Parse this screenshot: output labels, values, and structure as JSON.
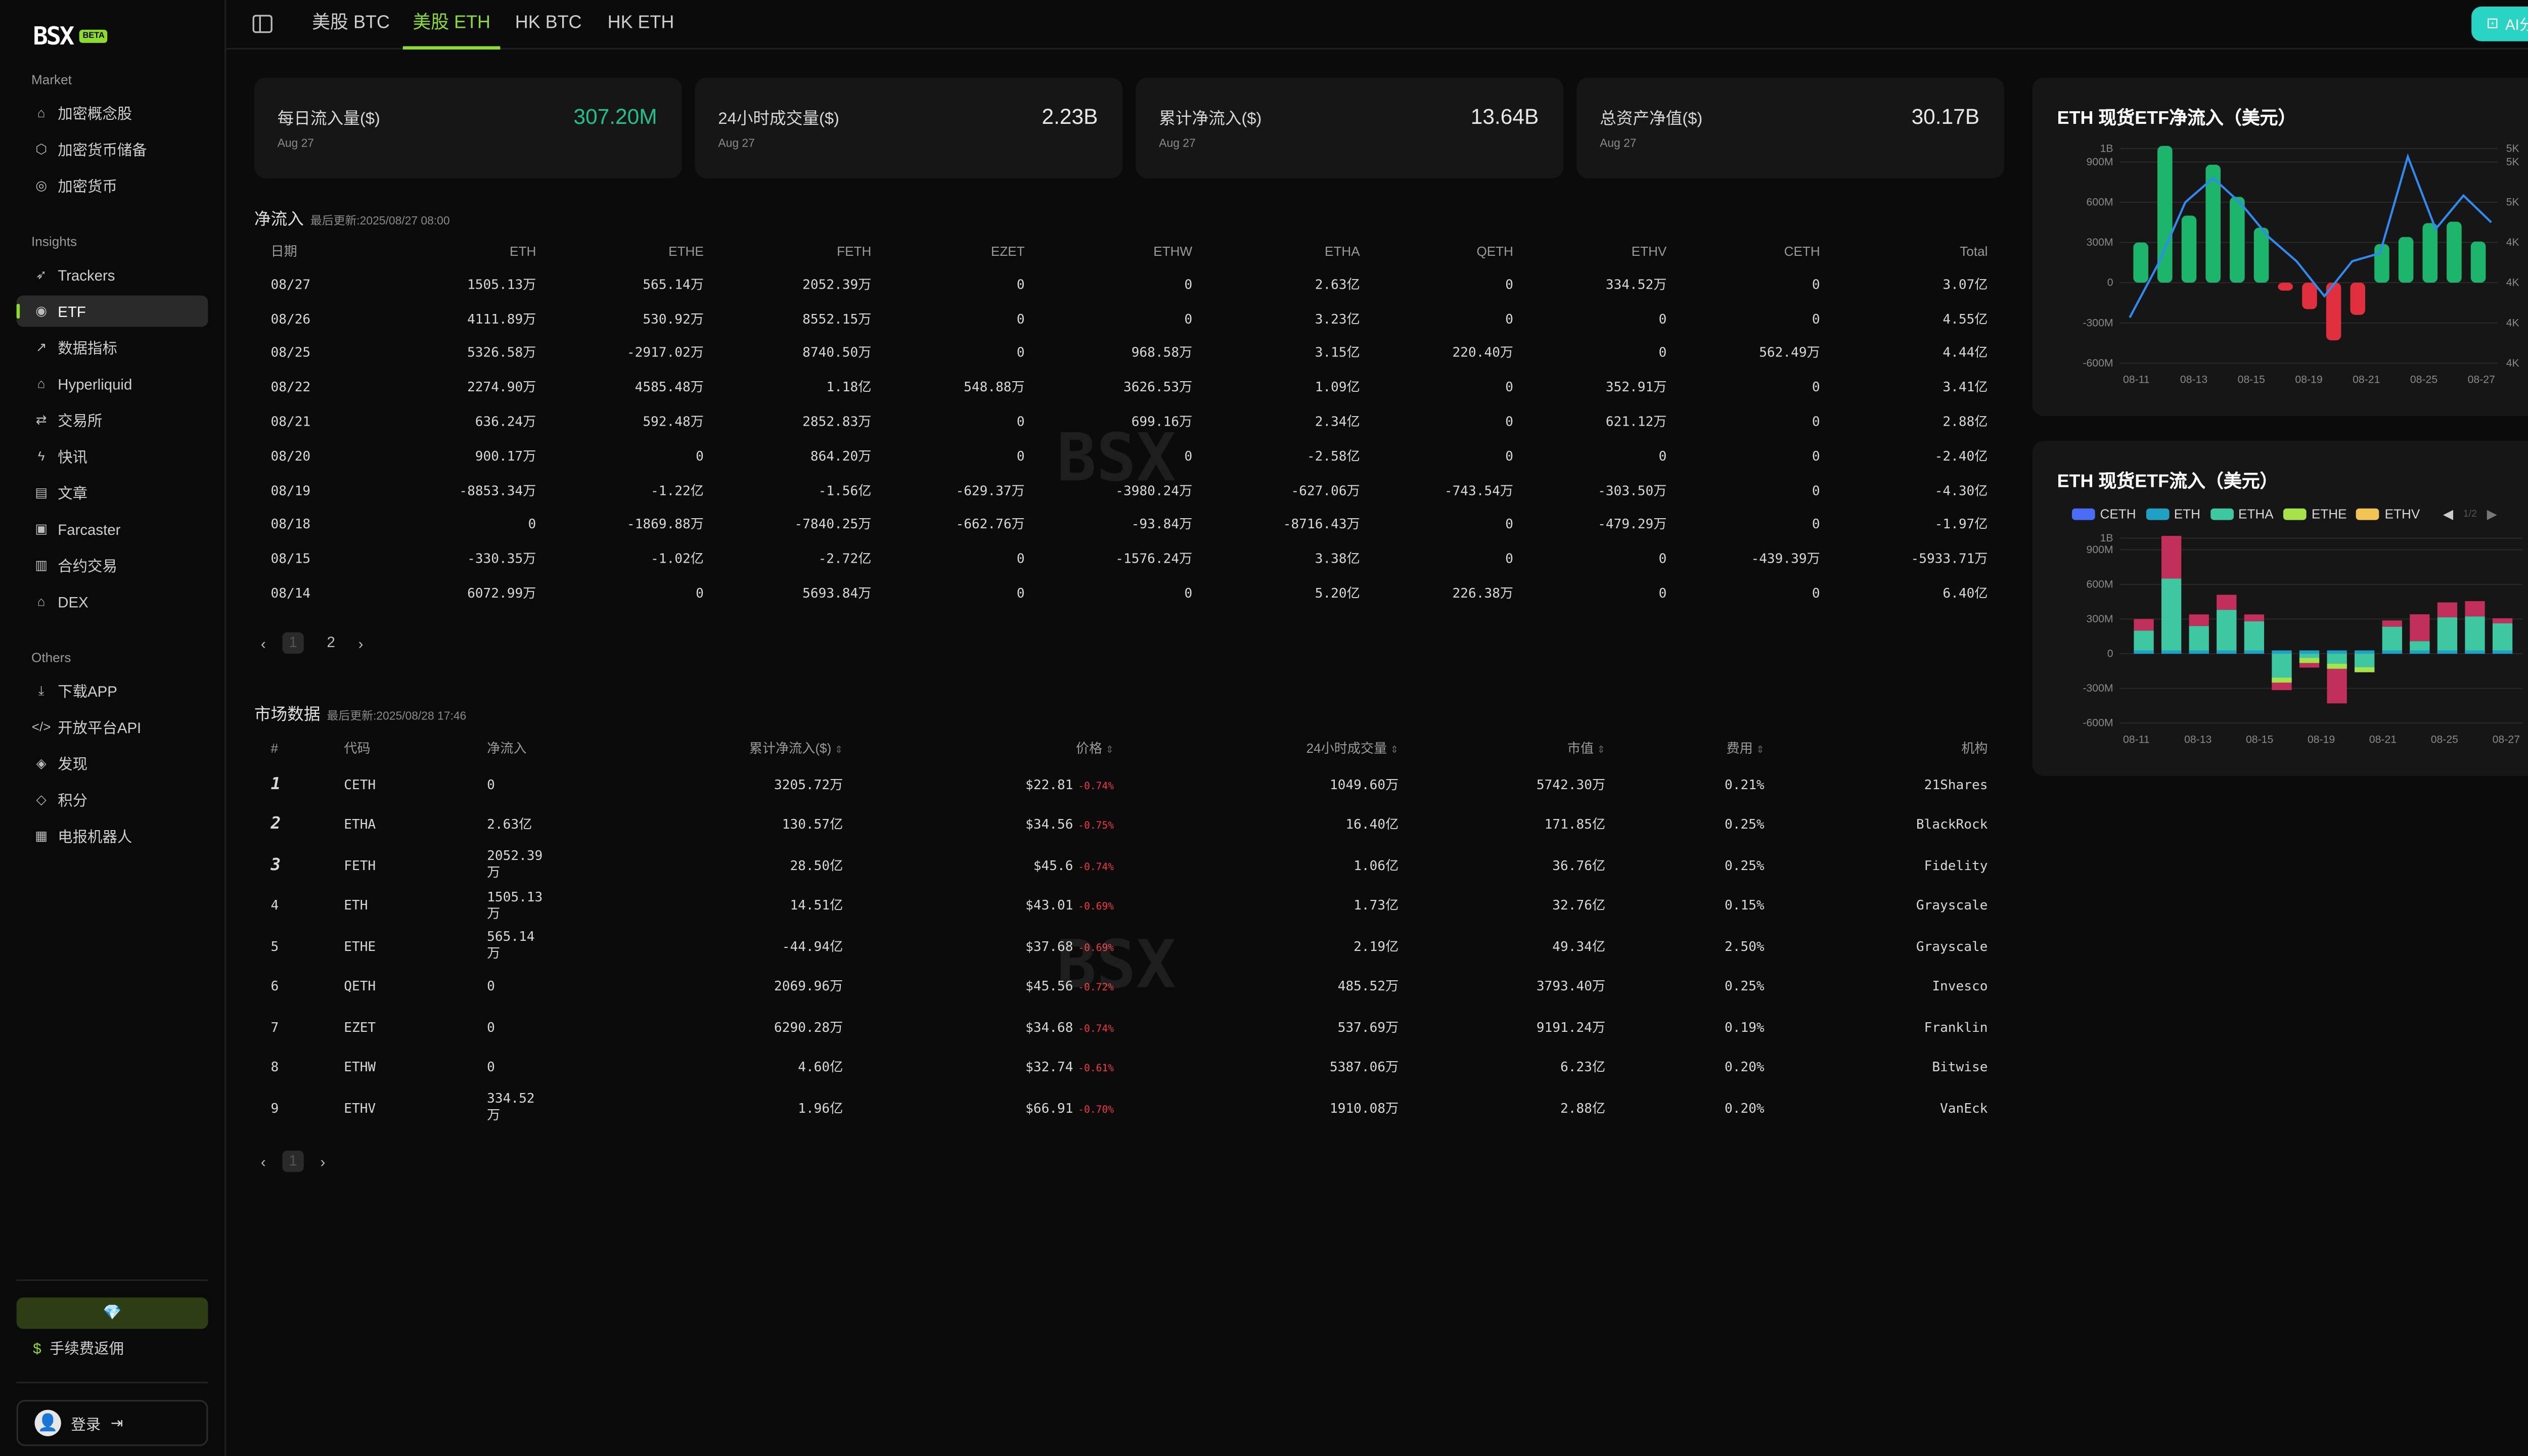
{
  "sidebar": {
    "logo": "BSX",
    "beta": "BETA",
    "sections": [
      {
        "title": "Market",
        "items": [
          {
            "label": "加密概念股",
            "icon": "building-icon"
          },
          {
            "label": "加密货币储备",
            "icon": "cube-icon"
          },
          {
            "label": "加密货币",
            "icon": "coin-icon"
          }
        ]
      },
      {
        "title": "Insights",
        "items": [
          {
            "label": "Trackers",
            "icon": "tracker-icon"
          },
          {
            "label": "ETF",
            "icon": "etf-icon"
          },
          {
            "label": "数据指标",
            "icon": "trend-icon"
          },
          {
            "label": "Hyperliquid",
            "icon": "home-icon"
          },
          {
            "label": "交易所",
            "icon": "exchange-icon"
          },
          {
            "label": "快讯",
            "icon": "bolt-icon"
          },
          {
            "label": "文章",
            "icon": "article-icon"
          },
          {
            "label": "Farcaster",
            "icon": "farcaster-icon"
          },
          {
            "label": "合约交易",
            "icon": "bar-chart-icon"
          },
          {
            "label": "DEX",
            "icon": "dex-icon"
          }
        ]
      },
      {
        "title": "Others",
        "items": [
          {
            "label": "下载APP",
            "icon": "download-icon"
          },
          {
            "label": "开放平台API",
            "icon": "code-icon"
          },
          {
            "label": "发现",
            "icon": "compass-icon"
          },
          {
            "label": "积分",
            "icon": "diamond-icon"
          },
          {
            "label": "电报机器人",
            "icon": "bot-icon"
          }
        ]
      }
    ],
    "rebate": "手续费返佣",
    "login": "登录"
  },
  "tabs": [
    "美股 BTC",
    "美股 ETH",
    "HK BTC",
    "HK ETH"
  ],
  "active_tab": "美股 ETH",
  "ai_button": "AI分析",
  "cards": [
    {
      "label": "每日流入量($)",
      "value": "307.20M",
      "date": "Aug 27"
    },
    {
      "label": "24小时成交量($)",
      "value": "2.23B",
      "date": "Aug 27"
    },
    {
      "label": "累计净流入($)",
      "value": "13.64B",
      "date": "Aug 27"
    },
    {
      "label": "总资产净值($)",
      "value": "30.17B",
      "date": "Aug 27"
    }
  ],
  "flow": {
    "title": "净流入",
    "updated": "最后更新:2025/08/27 08:00",
    "headers": [
      "日期",
      "ETH",
      "ETHE",
      "FETH",
      "EZET",
      "ETHW",
      "ETHA",
      "QETH",
      "ETHV",
      "CETH",
      "Total"
    ],
    "rows": [
      [
        "08/27",
        "1505.13万",
        "565.14万",
        "2052.39万",
        "0",
        "0",
        "2.63亿",
        "0",
        "334.52万",
        "0",
        "3.07亿"
      ],
      [
        "08/26",
        "4111.89万",
        "530.92万",
        "8552.15万",
        "0",
        "0",
        "3.23亿",
        "0",
        "0",
        "0",
        "4.55亿"
      ],
      [
        "08/25",
        "5326.58万",
        "-2917.02万",
        "8740.50万",
        "0",
        "968.58万",
        "3.15亿",
        "220.40万",
        "0",
        "562.49万",
        "4.44亿"
      ],
      [
        "08/22",
        "2274.90万",
        "4585.48万",
        "1.18亿",
        "548.88万",
        "3626.53万",
        "1.09亿",
        "0",
        "352.91万",
        "0",
        "3.41亿"
      ],
      [
        "08/21",
        "636.24万",
        "592.48万",
        "2852.83万",
        "0",
        "699.16万",
        "2.34亿",
        "0",
        "621.12万",
        "0",
        "2.88亿"
      ],
      [
        "08/20",
        "900.17万",
        "0",
        "864.20万",
        "0",
        "0",
        "-2.58亿",
        "0",
        "0",
        "0",
        "-2.40亿"
      ],
      [
        "08/19",
        "-8853.34万",
        "-1.22亿",
        "-1.56亿",
        "-629.37万",
        "-3980.24万",
        "-627.06万",
        "-743.54万",
        "-303.50万",
        "0",
        "-4.30亿"
      ],
      [
        "08/18",
        "0",
        "-1869.88万",
        "-7840.25万",
        "-662.76万",
        "-93.84万",
        "-8716.43万",
        "0",
        "-479.29万",
        "0",
        "-1.97亿"
      ],
      [
        "08/15",
        "-330.35万",
        "-1.02亿",
        "-2.72亿",
        "0",
        "-1576.24万",
        "3.38亿",
        "0",
        "0",
        "-439.39万",
        "-5933.71万"
      ],
      [
        "08/14",
        "6072.99万",
        "0",
        "5693.84万",
        "0",
        "0",
        "5.20亿",
        "226.38万",
        "0",
        "0",
        "6.40亿"
      ]
    ],
    "pages": [
      "1",
      "2"
    ]
  },
  "market": {
    "title": "市场数据",
    "updated": "最后更新:2025/08/28 17:46",
    "headers": [
      "#",
      "代码",
      "净流入",
      "累计净流入($)",
      "价格",
      "24小时成交量",
      "市值",
      "费用",
      "机构"
    ],
    "rows": [
      [
        "1",
        "CETH",
        "0",
        "3205.72万",
        "$22.81",
        "-0.74%",
        "1049.60万",
        "5742.30万",
        "0.21%",
        "21Shares"
      ],
      [
        "2",
        "ETHA",
        "2.63亿",
        "130.57亿",
        "$34.56",
        "-0.75%",
        "16.40亿",
        "171.85亿",
        "0.25%",
        "BlackRock"
      ],
      [
        "3",
        "FETH",
        "2052.39万",
        "28.50亿",
        "$45.6",
        "-0.74%",
        "1.06亿",
        "36.76亿",
        "0.25%",
        "Fidelity"
      ],
      [
        "4",
        "ETH",
        "1505.13万",
        "14.51亿",
        "$43.01",
        "-0.69%",
        "1.73亿",
        "32.76亿",
        "0.15%",
        "Grayscale"
      ],
      [
        "5",
        "ETHE",
        "565.14万",
        "-44.94亿",
        "$37.68",
        "-0.69%",
        "2.19亿",
        "49.34亿",
        "2.50%",
        "Grayscale"
      ],
      [
        "6",
        "QETH",
        "0",
        "2069.96万",
        "$45.56",
        "-0.72%",
        "485.52万",
        "3793.40万",
        "0.25%",
        "Invesco"
      ],
      [
        "7",
        "EZET",
        "0",
        "6290.28万",
        "$34.68",
        "-0.74%",
        "537.69万",
        "9191.24万",
        "0.19%",
        "Franklin"
      ],
      [
        "8",
        "ETHW",
        "0",
        "4.60亿",
        "$32.74",
        "-0.61%",
        "5387.06万",
        "6.23亿",
        "0.20%",
        "Bitwise"
      ],
      [
        "9",
        "ETHV",
        "334.52万",
        "1.96亿",
        "$66.91",
        "-0.70%",
        "1910.08万",
        "2.88亿",
        "0.20%",
        "VanEck"
      ]
    ],
    "pages": [
      "1"
    ]
  },
  "chart_data": [
    {
      "type": "bar",
      "title": "ETH 现货ETF净流入（美元）",
      "categories": [
        "08-11",
        "08-12",
        "08-13",
        "08-14",
        "08-15",
        "08-18",
        "08-19",
        "08-20",
        "08-21",
        "08-22",
        "08-25",
        "08-26",
        "08-27"
      ],
      "x_tick_labels": [
        "08-11",
        "08-13",
        "08-15",
        "08-19",
        "08-21",
        "08-25",
        "08-27"
      ],
      "y_ticks": [
        "1B",
        "900M",
        "600M",
        "300M",
        "0",
        "-300M",
        "-600M"
      ],
      "y2_ticks": [
        "5K",
        "5K",
        "5K",
        "4K",
        "4K",
        "4K",
        "4K"
      ],
      "ylim": [
        -600,
        1000
      ],
      "series": [
        {
          "type": "bar",
          "values": [
            300,
            1020,
            500,
            880,
            640,
            410,
            -59,
            -197,
            -430,
            -240,
            288,
            341,
            444,
            455,
            307
          ]
        },
        {
          "type": "line",
          "values": [
            -260,
            130,
            600,
            780,
            590,
            340,
            160,
            -100,
            160,
            220,
            940,
            400,
            650,
            450
          ]
        }
      ],
      "colors": {
        "positive": "#1cb56b",
        "negative": "#e0303e",
        "line": "#2f8bf0"
      }
    },
    {
      "type": "bar",
      "title": "ETH 现货ETF流入（美元）",
      "legend": [
        "CETH",
        "ETH",
        "ETHA",
        "ETHE",
        "ETHV"
      ],
      "legend_colors": [
        "#4a6cf7",
        "#1fa1c6",
        "#3fc7a1",
        "#a6e34a",
        "#f1c453"
      ],
      "pager": "1/2",
      "categories": [
        "08-11",
        "08-12",
        "08-13",
        "08-14",
        "08-15",
        "08-18",
        "08-19",
        "08-20",
        "08-21",
        "08-22",
        "08-25",
        "08-26",
        "08-27"
      ],
      "x_tick_labels": [
        "08-11",
        "08-13",
        "08-15",
        "08-19",
        "08-21",
        "08-25",
        "08-27"
      ],
      "y_ticks": [
        "1B",
        "900M",
        "600M",
        "300M",
        "0",
        "-300M",
        "-600M"
      ],
      "ylim": [
        -600,
        1000
      ],
      "series": [
        {
          "name": "ETHA",
          "values": [
            200,
            650,
            240,
            380,
            280,
            -250,
            -80,
            -130,
            -160,
            234,
            109,
            315,
            323,
            263
          ]
        },
        {
          "name": "other-positive",
          "values": [
            100,
            370,
            100,
            130,
            60,
            0,
            0,
            0,
            0,
            54,
            232,
            129,
            132,
            44
          ]
        },
        {
          "name": "other-negative",
          "values": [
            0,
            0,
            0,
            0,
            0,
            -65,
            -40,
            -300,
            0,
            0,
            0,
            0,
            -29,
            0
          ]
        }
      ]
    }
  ]
}
